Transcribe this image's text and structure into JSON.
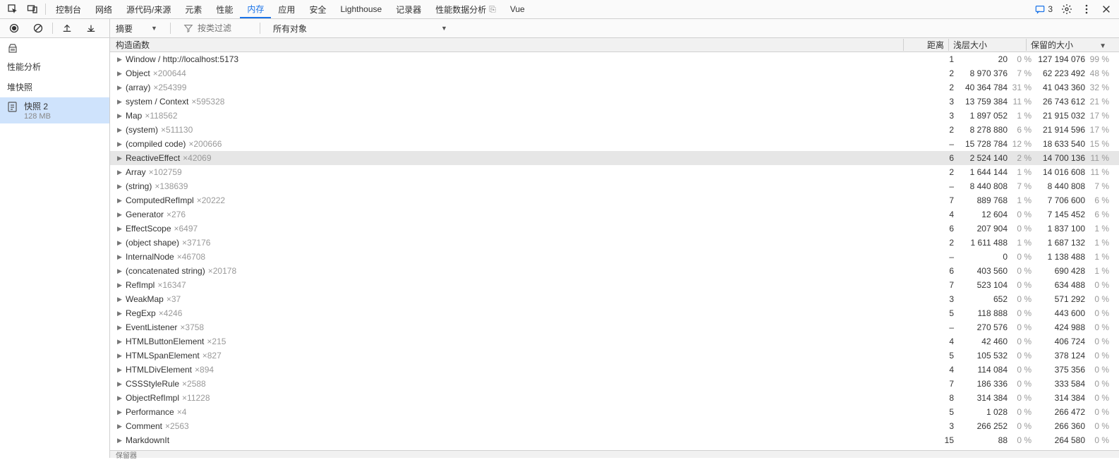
{
  "tabs": [
    "控制台",
    "网络",
    "源代码/来源",
    "元素",
    "性能",
    "内存",
    "应用",
    "安全",
    "Lighthouse",
    "记录器",
    "性能数据分析",
    "Vue"
  ],
  "active_tab_index": 5,
  "msg_count": "3",
  "toolbar": {
    "summary": "摘要",
    "filter_placeholder": "按类过滤",
    "all_objects": "所有对象"
  },
  "sidebar": {
    "sec1": "性能分析",
    "sec2": "堆快照",
    "item": {
      "title": "快照 2",
      "sub": "128 MB"
    }
  },
  "headers": {
    "c0": "构造函数",
    "c1": "距离",
    "c2": "浅层大小",
    "c3": "保留的大小"
  },
  "footer": "保留器",
  "rows": [
    {
      "name": "Window / http://localhost:5173",
      "cnt": "",
      "d": "1",
      "s": "20",
      "sp": "0 %",
      "r": "127 194 076",
      "rp": "99 %"
    },
    {
      "name": "Object",
      "cnt": "×200644",
      "d": "2",
      "s": "8 970 376",
      "sp": "7 %",
      "r": "62 223 492",
      "rp": "48 %"
    },
    {
      "name": "(array)",
      "cnt": "×254399",
      "d": "2",
      "s": "40 364 784",
      "sp": "31 %",
      "r": "41 043 360",
      "rp": "32 %"
    },
    {
      "name": "system / Context",
      "cnt": "×595328",
      "d": "3",
      "s": "13 759 384",
      "sp": "11 %",
      "r": "26 743 612",
      "rp": "21 %"
    },
    {
      "name": "Map",
      "cnt": "×118562",
      "d": "3",
      "s": "1 897 052",
      "sp": "1 %",
      "r": "21 915 032",
      "rp": "17 %"
    },
    {
      "name": "(system)",
      "cnt": "×511130",
      "d": "2",
      "s": "8 278 880",
      "sp": "6 %",
      "r": "21 914 596",
      "rp": "17 %"
    },
    {
      "name": "(compiled code)",
      "cnt": "×200666",
      "d": "–",
      "s": "15 728 784",
      "sp": "12 %",
      "r": "18 633 540",
      "rp": "15 %"
    },
    {
      "name": "ReactiveEffect",
      "cnt": "×42069",
      "d": "6",
      "s": "2 524 140",
      "sp": "2 %",
      "r": "14 700 136",
      "rp": "11 %",
      "sel": true
    },
    {
      "name": "Array",
      "cnt": "×102759",
      "d": "2",
      "s": "1 644 144",
      "sp": "1 %",
      "r": "14 016 608",
      "rp": "11 %"
    },
    {
      "name": "(string)",
      "cnt": "×138639",
      "d": "–",
      "s": "8 440 808",
      "sp": "7 %",
      "r": "8 440 808",
      "rp": "7 %"
    },
    {
      "name": "ComputedRefImpl",
      "cnt": "×20222",
      "d": "7",
      "s": "889 768",
      "sp": "1 %",
      "r": "7 706 600",
      "rp": "6 %"
    },
    {
      "name": "Generator",
      "cnt": "×276",
      "d": "4",
      "s": "12 604",
      "sp": "0 %",
      "r": "7 145 452",
      "rp": "6 %"
    },
    {
      "name": "EffectScope",
      "cnt": "×6497",
      "d": "6",
      "s": "207 904",
      "sp": "0 %",
      "r": "1 837 100",
      "rp": "1 %"
    },
    {
      "name": "(object shape)",
      "cnt": "×37176",
      "d": "2",
      "s": "1 611 488",
      "sp": "1 %",
      "r": "1 687 132",
      "rp": "1 %"
    },
    {
      "name": "InternalNode",
      "cnt": "×46708",
      "d": "–",
      "s": "0",
      "sp": "0 %",
      "r": "1 138 488",
      "rp": "1 %"
    },
    {
      "name": "(concatenated string)",
      "cnt": "×20178",
      "d": "6",
      "s": "403 560",
      "sp": "0 %",
      "r": "690 428",
      "rp": "1 %"
    },
    {
      "name": "RefImpl",
      "cnt": "×16347",
      "d": "7",
      "s": "523 104",
      "sp": "0 %",
      "r": "634 488",
      "rp": "0 %"
    },
    {
      "name": "WeakMap",
      "cnt": "×37",
      "d": "3",
      "s": "652",
      "sp": "0 %",
      "r": "571 292",
      "rp": "0 %"
    },
    {
      "name": "RegExp",
      "cnt": "×4246",
      "d": "5",
      "s": "118 888",
      "sp": "0 %",
      "r": "443 600",
      "rp": "0 %"
    },
    {
      "name": "EventListener",
      "cnt": "×3758",
      "d": "–",
      "s": "270 576",
      "sp": "0 %",
      "r": "424 988",
      "rp": "0 %"
    },
    {
      "name": "HTMLButtonElement",
      "cnt": "×215",
      "d": "4",
      "s": "42 460",
      "sp": "0 %",
      "r": "406 724",
      "rp": "0 %"
    },
    {
      "name": "HTMLSpanElement",
      "cnt": "×827",
      "d": "5",
      "s": "105 532",
      "sp": "0 %",
      "r": "378 124",
      "rp": "0 %"
    },
    {
      "name": "HTMLDivElement",
      "cnt": "×894",
      "d": "4",
      "s": "114 084",
      "sp": "0 %",
      "r": "375 356",
      "rp": "0 %"
    },
    {
      "name": "CSSStyleRule",
      "cnt": "×2588",
      "d": "7",
      "s": "186 336",
      "sp": "0 %",
      "r": "333 584",
      "rp": "0 %"
    },
    {
      "name": "ObjectRefImpl",
      "cnt": "×11228",
      "d": "8",
      "s": "314 384",
      "sp": "0 %",
      "r": "314 384",
      "rp": "0 %"
    },
    {
      "name": "Performance",
      "cnt": "×4",
      "d": "5",
      "s": "1 028",
      "sp": "0 %",
      "r": "266 472",
      "rp": "0 %"
    },
    {
      "name": "Comment",
      "cnt": "×2563",
      "d": "3",
      "s": "266 252",
      "sp": "0 %",
      "r": "266 360",
      "rp": "0 %"
    },
    {
      "name": "MarkdownIt",
      "cnt": "",
      "d": "15",
      "s": "88",
      "sp": "0 %",
      "r": "264 580",
      "rp": "0 %"
    }
  ]
}
